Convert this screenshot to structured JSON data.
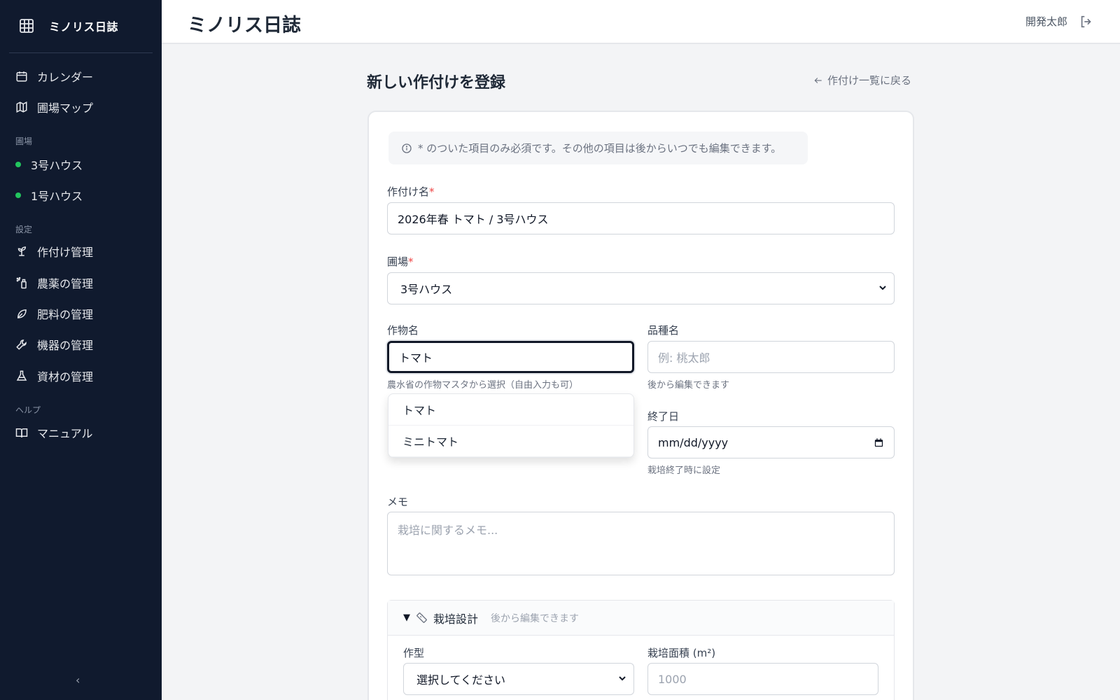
{
  "app": {
    "brand": "ミノリス日誌",
    "page_title": "ミノリス日誌"
  },
  "sidebar": {
    "items_top": [
      {
        "label": "カレンダー",
        "icon": "calendar-icon"
      },
      {
        "label": "圃場マップ",
        "icon": "map-icon"
      }
    ],
    "section_fields": "圃場",
    "fields": [
      {
        "label": "3号ハウス",
        "status_color": "#22c55e"
      },
      {
        "label": "1号ハウス",
        "status_color": "#22c55e"
      }
    ],
    "section_settings": "設定",
    "settings": [
      {
        "label": "作付け管理",
        "icon": "sprout-icon"
      },
      {
        "label": "農薬の管理",
        "icon": "spray-icon"
      },
      {
        "label": "肥料の管理",
        "icon": "leaf-icon"
      },
      {
        "label": "機器の管理",
        "icon": "wrench-icon"
      },
      {
        "label": "資材の管理",
        "icon": "flask-icon"
      }
    ],
    "section_help": "ヘルプ",
    "help": [
      {
        "label": "マニュアル",
        "icon": "book-icon"
      }
    ],
    "collapse_glyph": "‹"
  },
  "header": {
    "user_name": "開発太郎"
  },
  "main": {
    "title": "新しい作付けを登録",
    "back_link": "作付け一覧に戻る",
    "info": "* のついた項目のみ必須です。その他の項目は後からいつでも編集できます。",
    "crop_name": {
      "label": "作付け名",
      "required_mark": "*",
      "value": "2026年春 トマト / 3号ハウス"
    },
    "field": {
      "label": "圃場",
      "required_mark": "*",
      "value": "3号ハウス"
    },
    "crop": {
      "label": "作物名",
      "value": "トマト",
      "hint": "農水省の作物マスタから選択（自由入力も可）"
    },
    "variety": {
      "label": "品種名",
      "placeholder": "例: 桃太郎",
      "hint": "後から編集できます"
    },
    "suggestions": [
      "トマト",
      "ミニトマト"
    ],
    "end_date": {
      "label": "終了日",
      "placeholder": "mm/dd/yyyy",
      "hint": "栽培終了時に設定"
    },
    "memo": {
      "label": "メモ",
      "placeholder": "栽培に関するメモ..."
    },
    "design": {
      "toggle": "▼",
      "title": "栽培設計",
      "subtitle": "後から編集できます",
      "type_label": "作型",
      "type_value": "選択してください",
      "area_label": "栽培面積 (m²)",
      "area_placeholder": "1000"
    }
  }
}
